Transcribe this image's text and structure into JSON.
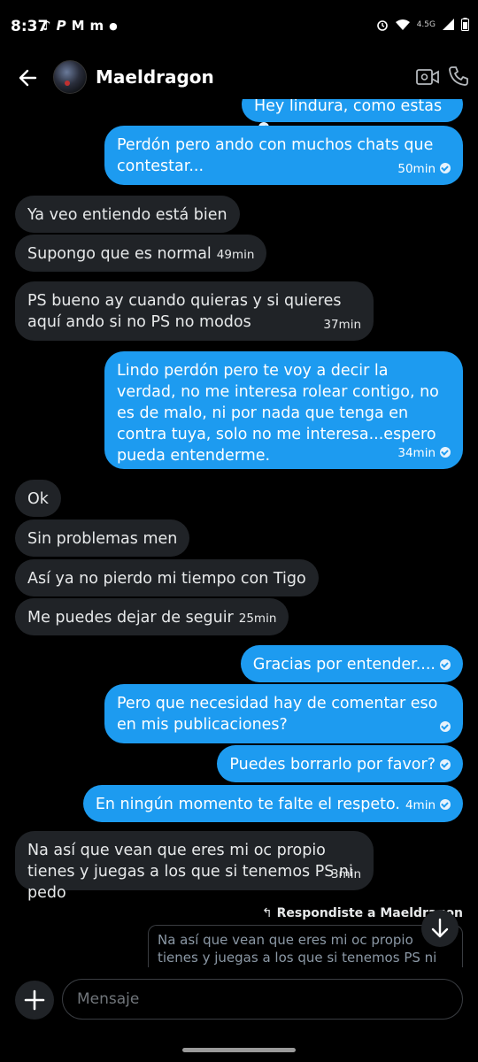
{
  "status_bar": {
    "time": "8:37",
    "network": "4.5G",
    "left_icons": [
      "tiktok-icon",
      "p-icon",
      "gmail-icon",
      "mcdonalds-icon",
      "dot-icon"
    ],
    "right_icons": [
      "alarm-icon",
      "wifi-icon",
      "signal-icon",
      "battery-icon"
    ]
  },
  "header": {
    "contact_name": "Maeldragon"
  },
  "messages": [
    {
      "dir": "out",
      "text": "Hey lindura, como estas",
      "time": ""
    },
    {
      "dir": "out",
      "text": "Perdón pero ando con muchos chats que contestar...",
      "time": "50min"
    },
    {
      "dir": "in",
      "text": "Ya veo entiendo está bien",
      "time": ""
    },
    {
      "dir": "in",
      "text": "Supongo que es normal",
      "time": "49min"
    },
    {
      "dir": "in",
      "text": "PS bueno ay cuando quieras y si quieres aquí ando si no PS no modos",
      "time": "37min"
    },
    {
      "dir": "out",
      "text": "Lindo perdón pero te voy a decir la verdad, no me interesa rolear contigo, no es de malo, ni por nada que tenga en contra tuya, solo no me interesa...espero pueda entenderme.",
      "time": "34min"
    },
    {
      "dir": "in",
      "text": "Ok",
      "time": ""
    },
    {
      "dir": "in",
      "text": "Sin problemas men",
      "time": ""
    },
    {
      "dir": "in",
      "text": "Así ya no pierdo mi tiempo con Tigo",
      "time": ""
    },
    {
      "dir": "in",
      "text": "Me puedes dejar de seguir",
      "time": "25min"
    },
    {
      "dir": "out",
      "text": "Gracias por entender....",
      "time": ""
    },
    {
      "dir": "out",
      "text": "Pero que necesidad hay de comentar eso en mis publicaciones?",
      "time": ""
    },
    {
      "dir": "out",
      "text": "Puedes borrarlo por favor?",
      "time": ""
    },
    {
      "dir": "out",
      "text": "En ningún momento te falte el respeto.",
      "time": "4min"
    },
    {
      "dir": "in",
      "text": "Na así que vean que eres mi oc propio tienes y juegas a los que si tenemos PS ni pedo",
      "time": "3min"
    }
  ],
  "reply": {
    "label": "Respondiste a Maeldragon",
    "quoted_text": "Na así que vean que eres mi oc propio tienes y juegas a los que si tenemos PS ni pedo"
  },
  "composer": {
    "placeholder": "Mensaje"
  },
  "colors": {
    "accent": "#1d9bf0",
    "incoming_bubble": "#202327",
    "background": "#000000"
  }
}
